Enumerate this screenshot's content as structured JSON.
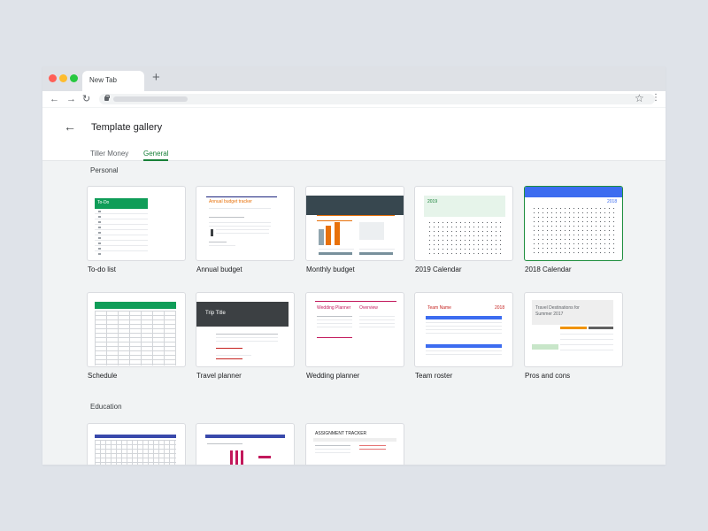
{
  "browser": {
    "tab_title": "New Tab",
    "new_tab_icon": "+",
    "back_icon": "←",
    "forward_icon": "→",
    "reload_icon": "↻",
    "star_icon": "☆",
    "menu_icon": "⋮"
  },
  "page": {
    "back_icon": "←",
    "title": "Template gallery",
    "tabs": [
      "Tiller Money",
      "General"
    ],
    "active_tab": "General"
  },
  "sections": [
    {
      "title": "Personal",
      "templates": [
        "To-do list",
        "Annual budget",
        "Monthly budget",
        "2019 Calendar",
        "2018 Calendar",
        "Schedule",
        "Travel planner",
        "Wedding planner",
        "Team roster",
        "Pros and cons"
      ]
    },
    {
      "title": "Education",
      "templates": [
        "",
        "",
        ""
      ]
    }
  ],
  "thumbnails": {
    "todo_title": "To-Do",
    "budget_title": "Annual budget tracker",
    "calendar_2019_year": "2019",
    "calendar_2018_year": "2018",
    "trip_title": "Trip Title",
    "wedding_title": "Wedding Planner",
    "wedding_sub": "Overview",
    "roster_title": "Team Name",
    "roster_year": "2018",
    "pros_title_1": "Travel Destinations for",
    "pros_title_2": "Summer 2017",
    "assignment_title": "ASSIGNMENT TRACKER"
  },
  "colors": {
    "selected_border": "#1e8e3e",
    "active_tab": "#188038",
    "sheets_green": "#0f9d58",
    "calendar_blue": "#3c6cf0"
  }
}
